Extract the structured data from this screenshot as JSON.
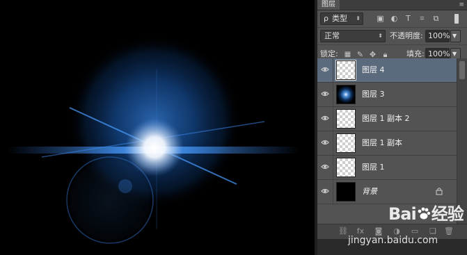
{
  "panel": {
    "tab_title": "图层",
    "filter": {
      "label": "类型",
      "prefix": "ρ"
    },
    "blend_mode": "正常",
    "opacity_label": "不透明度:",
    "opacity_value": "100%",
    "lock_label": "锁定:",
    "fill_label": "填充:",
    "fill_value": "100%"
  },
  "layers": [
    {
      "name": "图层 4",
      "thumb": "transparent",
      "selected": true
    },
    {
      "name": "图层 3",
      "thumb": "flare",
      "selected": false
    },
    {
      "name": "图层 1 副本 2",
      "thumb": "transparent",
      "selected": false
    },
    {
      "name": "图层 1 副本",
      "thumb": "transparent",
      "selected": false
    },
    {
      "name": "图层 1",
      "thumb": "transparent",
      "selected": false
    },
    {
      "name": "背景",
      "thumb": "black",
      "selected": false,
      "locked": true
    }
  ],
  "watermark": {
    "logo_text_a": "Bai",
    "logo_text_b": "经验",
    "url": "jingyan.baidu.com"
  },
  "colors": {
    "canvas_bg": "#000000",
    "panel_bg": "#535353",
    "selected_layer": "#5b6b7d",
    "flare_blue": "#2f7fe0"
  }
}
